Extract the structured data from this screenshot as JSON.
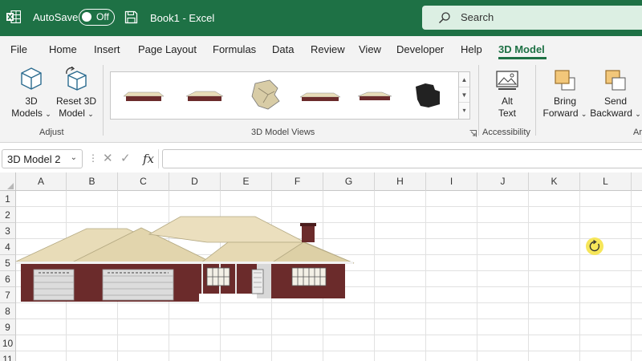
{
  "titlebar": {
    "autosave_label": "AutoSave",
    "autosave_state": "Off",
    "document_title": "Book1  -  Excel",
    "search_placeholder": "Search"
  },
  "tabs": [
    "File",
    "Home",
    "Insert",
    "Page Layout",
    "Formulas",
    "Data",
    "Review",
    "View",
    "Developer",
    "Help",
    "3D Model"
  ],
  "active_tab": "3D Model",
  "ribbon": {
    "adjust": {
      "models_line1": "3D",
      "models_line2": "Models",
      "reset_line1": "Reset 3D",
      "reset_line2": "Model",
      "group_label": "Adjust"
    },
    "views": {
      "group_label": "3D Model Views",
      "item_count": 6
    },
    "accessibility": {
      "alt_line1": "Alt",
      "alt_line2": "Text",
      "group_label": "Accessibility"
    },
    "arrange": {
      "bring_line1": "Bring",
      "bring_line2": "Forward",
      "send_line1": "Send",
      "send_line2": "Backward",
      "group_label_partial": "Ar"
    }
  },
  "formula_bar": {
    "name_box": "3D Model 2",
    "fx_label": "fx",
    "formula": ""
  },
  "grid": {
    "columns": [
      "A",
      "B",
      "C",
      "D",
      "E",
      "F",
      "G",
      "H",
      "I",
      "J",
      "K",
      "L"
    ],
    "rows": [
      "1",
      "2",
      "3",
      "4",
      "5",
      "6",
      "7",
      "8",
      "9",
      "10",
      "11"
    ]
  },
  "colors": {
    "excel_green": "#1e7145",
    "roof": "#e8dcb8",
    "brick": "#6b2b2b",
    "rotate_handle": "#f6e65a"
  },
  "icons": {
    "app": "excel-logo-icon",
    "save": "save-icon",
    "search": "search-icon",
    "rotate": "rotate-handle-icon"
  }
}
